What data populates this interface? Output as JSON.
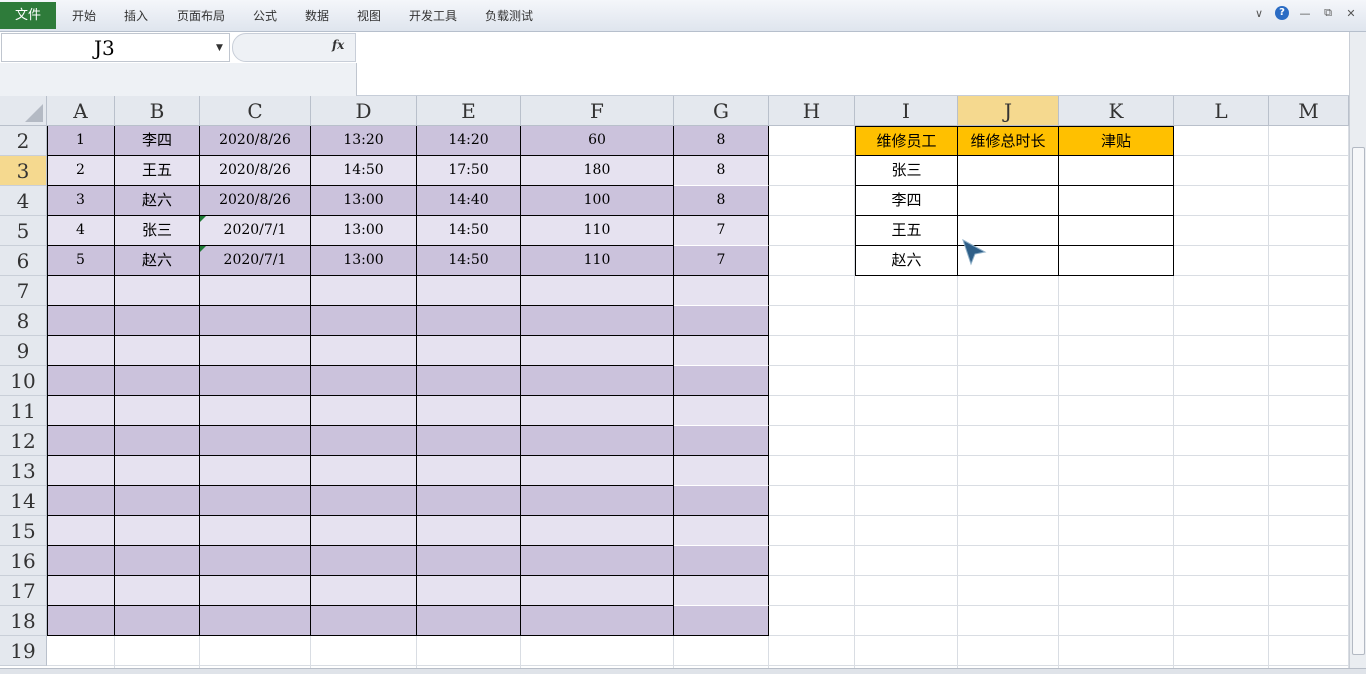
{
  "ribbon": {
    "file_tab": "文件",
    "tabs": [
      "开始",
      "插入",
      "页面布局",
      "公式",
      "数据",
      "视图",
      "开发工具",
      "负载测试"
    ]
  },
  "window_controls": {
    "help": "?",
    "icons": [
      "chevron-down-icon",
      "help-icon",
      "minimize-icon",
      "restore-icon",
      "close-icon"
    ]
  },
  "formula_bar": {
    "name_box": "J3",
    "fx_label": "fx",
    "formula": ""
  },
  "columns": [
    "A",
    "B",
    "C",
    "D",
    "E",
    "F",
    "G",
    "H",
    "I",
    "J",
    "K",
    "L",
    "M"
  ],
  "selected_column": "J",
  "rows": [
    "2",
    "3",
    "4",
    "5",
    "6",
    "7",
    "8",
    "9",
    "10",
    "11",
    "12",
    "13",
    "14",
    "15",
    "16",
    "17",
    "18",
    "19"
  ],
  "selected_row": "3",
  "table": [
    [
      "1",
      "李四",
      "2020/8/26",
      "13:20",
      "14:20",
      "60",
      "8"
    ],
    [
      "2",
      "王五",
      "2020/8/26",
      "14:50",
      "17:50",
      "180",
      "8"
    ],
    [
      "3",
      "赵六",
      "2020/8/26",
      "13:00",
      "14:40",
      "100",
      "8"
    ],
    [
      "4",
      "张三",
      "2020/7/1",
      "13:00",
      "14:50",
      "110",
      "7"
    ],
    [
      "5",
      "赵六",
      "2020/7/1",
      "13:00",
      "14:50",
      "110",
      "7"
    ]
  ],
  "summary": {
    "headers": [
      "维修员工",
      "维修总时长",
      "津贴"
    ],
    "employees": [
      "张三",
      "李四",
      "王五",
      "赵六"
    ]
  },
  "colors": {
    "band_dark": "#cbc2dc",
    "band_light": "#e6e2f0",
    "header_fill": "#ffc000",
    "file_tab": "#2e7b3a"
  }
}
